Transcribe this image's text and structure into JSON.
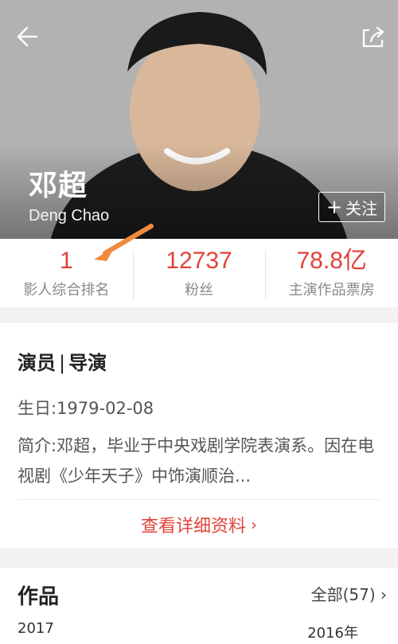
{
  "header": {
    "name_cn": "邓超",
    "name_en": "Deng Chao",
    "follow_label": "关注"
  },
  "icons": {
    "back": "back-arrow-icon",
    "share": "share-icon",
    "follow_plus": "plus-icon"
  },
  "stats": [
    {
      "value": "1",
      "label": "影人综合排名"
    },
    {
      "value": "12737",
      "label": "粉丝"
    },
    {
      "value": "78.8亿",
      "label": "主演作品票房"
    }
  ],
  "profile": {
    "role_actor": "演员",
    "role_sep": "|",
    "role_director": "导演",
    "birthday": "生日:1979-02-08",
    "intro": "简介:邓超，毕业于中央戏剧学院表演系。因在电视剧《少年天子》中饰演顺治...",
    "more_label": "查看详细资料"
  },
  "works": {
    "title": "作品",
    "all_label": "全部(57)",
    "year_left": "2017",
    "year_right": "2016年"
  },
  "colors": {
    "accent": "#e0433a",
    "arrow": "#f08a3c"
  }
}
